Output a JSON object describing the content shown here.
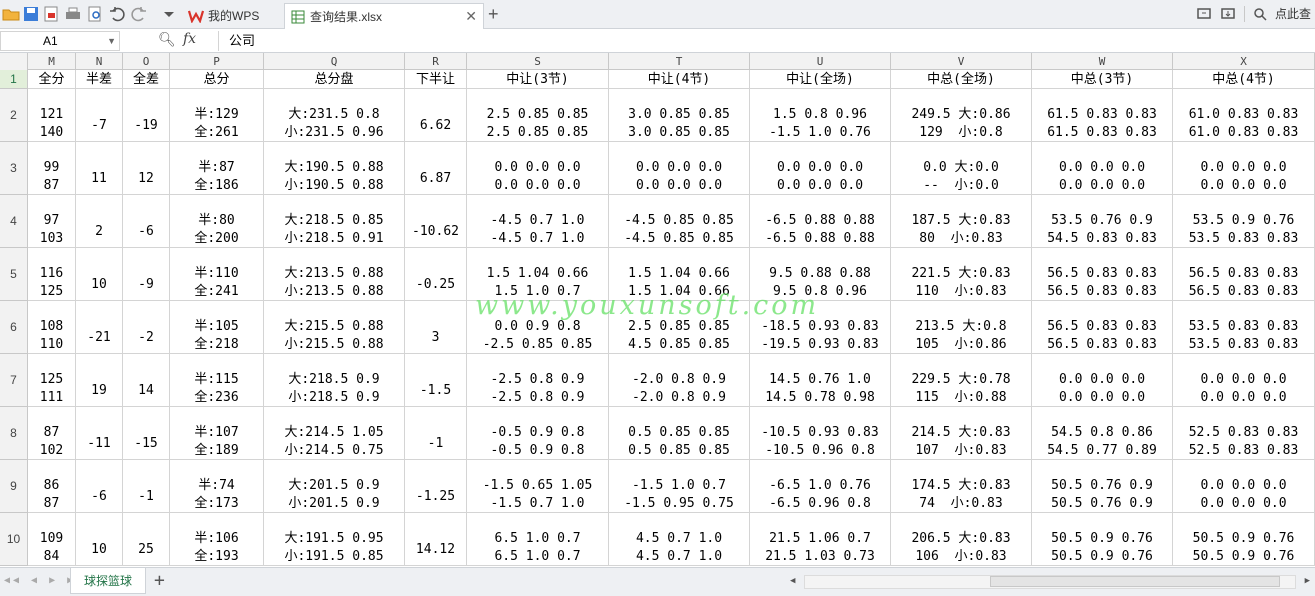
{
  "tabs": [
    {
      "label": "我的WPS"
    },
    {
      "label": "查询结果.xlsx"
    }
  ],
  "search_label": "点此查",
  "name_box": "A1",
  "formula_value": "公司",
  "sheet_tab": "球探篮球",
  "watermark": "www.youxunsoft.com",
  "columns": [
    "M",
    "N",
    "O",
    "P",
    "Q",
    "R",
    "S",
    "T",
    "U",
    "V",
    "W",
    "X"
  ],
  "headers": [
    "全分",
    "半差",
    "全差",
    "总分",
    "总分盘",
    "下半让",
    "中让(3节)",
    "中让(4节)",
    "中让(全场)",
    "中总(全场)",
    "中总(3节)",
    "中总(4节)"
  ],
  "rows": [
    {
      "num": "1"
    },
    {
      "num": "2",
      "cells": [
        [
          "121",
          "140"
        ],
        [
          "",
          "-7"
        ],
        [
          "",
          "-19"
        ],
        [
          "半:129",
          "全:261"
        ],
        [
          "大:231.5 0.8",
          "小:231.5 0.96"
        ],
        [
          "",
          "6.62"
        ],
        [
          "2.5 0.85 0.85",
          "2.5 0.85 0.85"
        ],
        [
          "3.0 0.85 0.85",
          "3.0 0.85 0.85"
        ],
        [
          "1.5 0.8 0.96",
          "-1.5 1.0 0.76"
        ],
        [
          "249.5 大:0.86",
          "129  小:0.8"
        ],
        [
          "61.5 0.83 0.83",
          "61.5 0.83 0.83"
        ],
        [
          "61.0 0.83 0.83",
          "61.0 0.83 0.83"
        ]
      ]
    },
    {
      "num": "3",
      "cells": [
        [
          "99",
          "87"
        ],
        [
          "",
          "11"
        ],
        [
          "",
          "12"
        ],
        [
          "半:87",
          "全:186"
        ],
        [
          "大:190.5 0.88",
          "小:190.5 0.88"
        ],
        [
          "",
          "6.87"
        ],
        [
          "0.0 0.0 0.0",
          "0.0 0.0 0.0"
        ],
        [
          "0.0 0.0 0.0",
          "0.0 0.0 0.0"
        ],
        [
          "0.0 0.0 0.0",
          "0.0 0.0 0.0"
        ],
        [
          "0.0 大:0.0",
          "--  小:0.0"
        ],
        [
          "0.0 0.0 0.0",
          "0.0 0.0 0.0"
        ],
        [
          "0.0 0.0 0.0",
          "0.0 0.0 0.0"
        ]
      ]
    },
    {
      "num": "4",
      "cells": [
        [
          "97",
          "103"
        ],
        [
          "",
          "2"
        ],
        [
          "",
          "-6"
        ],
        [
          "半:80",
          "全:200"
        ],
        [
          "大:218.5 0.85",
          "小:218.5 0.91"
        ],
        [
          "",
          "-10.62"
        ],
        [
          "-4.5 0.7 1.0",
          "-4.5 0.7 1.0"
        ],
        [
          "-4.5 0.85 0.85",
          "-4.5 0.85 0.85"
        ],
        [
          "-6.5 0.88 0.88",
          "-6.5 0.88 0.88"
        ],
        [
          "187.5 大:0.83",
          "80  小:0.83"
        ],
        [
          "53.5 0.76 0.9",
          "54.5 0.83 0.83"
        ],
        [
          "53.5 0.9 0.76",
          "53.5 0.83 0.83"
        ]
      ]
    },
    {
      "num": "5",
      "cells": [
        [
          "116",
          "125"
        ],
        [
          "",
          "10"
        ],
        [
          "",
          "-9"
        ],
        [
          "半:110",
          "全:241"
        ],
        [
          "大:213.5 0.88",
          "小:213.5 0.88"
        ],
        [
          "",
          "-0.25"
        ],
        [
          "1.5 1.04 0.66",
          "1.5 1.0 0.7"
        ],
        [
          "1.5 1.04 0.66",
          "1.5 1.04 0.66"
        ],
        [
          "9.5 0.88 0.88",
          "9.5 0.8 0.96"
        ],
        [
          "221.5 大:0.83",
          "110  小:0.83"
        ],
        [
          "56.5 0.83 0.83",
          "56.5 0.83 0.83"
        ],
        [
          "56.5 0.83 0.83",
          "56.5 0.83 0.83"
        ]
      ]
    },
    {
      "num": "6",
      "cells": [
        [
          "108",
          "110"
        ],
        [
          "",
          "-21"
        ],
        [
          "",
          "-2"
        ],
        [
          "半:105",
          "全:218"
        ],
        [
          "大:215.5 0.88",
          "小:215.5 0.88"
        ],
        [
          "",
          "3"
        ],
        [
          "0.0 0.9 0.8",
          "-2.5 0.85 0.85"
        ],
        [
          "2.5 0.85 0.85",
          "4.5 0.85 0.85"
        ],
        [
          "-18.5 0.93 0.83",
          "-19.5 0.93 0.83"
        ],
        [
          "213.5 大:0.8",
          "105  小:0.86"
        ],
        [
          "56.5 0.83 0.83",
          "56.5 0.83 0.83"
        ],
        [
          "53.5 0.83 0.83",
          "53.5 0.83 0.83"
        ]
      ]
    },
    {
      "num": "7",
      "cells": [
        [
          "125",
          "111"
        ],
        [
          "",
          "19"
        ],
        [
          "",
          "14"
        ],
        [
          "半:115",
          "全:236"
        ],
        [
          "大:218.5 0.9",
          "小:218.5 0.9"
        ],
        [
          "",
          "-1.5"
        ],
        [
          "-2.5 0.8 0.9",
          "-2.5 0.8 0.9"
        ],
        [
          "-2.0 0.8 0.9",
          "-2.0 0.8 0.9"
        ],
        [
          "14.5 0.76 1.0",
          "14.5 0.78 0.98"
        ],
        [
          "229.5 大:0.78",
          "115  小:0.88"
        ],
        [
          "0.0 0.0 0.0",
          "0.0 0.0 0.0"
        ],
        [
          "0.0 0.0 0.0",
          "0.0 0.0 0.0"
        ]
      ]
    },
    {
      "num": "8",
      "cells": [
        [
          "87",
          "102"
        ],
        [
          "",
          "-11"
        ],
        [
          "",
          "-15"
        ],
        [
          "半:107",
          "全:189"
        ],
        [
          "大:214.5 1.05",
          "小:214.5 0.75"
        ],
        [
          "",
          "-1"
        ],
        [
          "-0.5 0.9 0.8",
          "-0.5 0.9 0.8"
        ],
        [
          "0.5 0.85 0.85",
          "0.5 0.85 0.85"
        ],
        [
          "-10.5 0.93 0.83",
          "-10.5 0.96 0.8"
        ],
        [
          "214.5 大:0.83",
          "107  小:0.83"
        ],
        [
          "54.5 0.8 0.86",
          "54.5 0.77 0.89"
        ],
        [
          "52.5 0.83 0.83",
          "52.5 0.83 0.83"
        ]
      ]
    },
    {
      "num": "9",
      "cells": [
        [
          "86",
          "87"
        ],
        [
          "",
          "-6"
        ],
        [
          "",
          "-1"
        ],
        [
          "半:74",
          "全:173"
        ],
        [
          "大:201.5 0.9",
          "小:201.5 0.9"
        ],
        [
          "",
          "-1.25"
        ],
        [
          "-1.5 0.65 1.05",
          "-1.5 0.7 1.0"
        ],
        [
          "-1.5 1.0 0.7",
          "-1.5 0.95 0.75"
        ],
        [
          "-6.5 1.0 0.76",
          "-6.5 0.96 0.8"
        ],
        [
          "174.5 大:0.83",
          "74  小:0.83"
        ],
        [
          "50.5 0.76 0.9",
          "50.5 0.76 0.9"
        ],
        [
          "0.0 0.0 0.0",
          "0.0 0.0 0.0"
        ]
      ]
    },
    {
      "num": "10",
      "cells": [
        [
          "109",
          "84"
        ],
        [
          "",
          "10"
        ],
        [
          "",
          "25"
        ],
        [
          "半:106",
          "全:193"
        ],
        [
          "大:191.5 0.95",
          "小:191.5 0.85"
        ],
        [
          "",
          "14.12"
        ],
        [
          "6.5 1.0 0.7",
          "6.5 1.0 0.7"
        ],
        [
          "4.5 0.7 1.0",
          "4.5 0.7 1.0"
        ],
        [
          "21.5 1.06 0.7",
          "21.5 1.03 0.73"
        ],
        [
          "206.5 大:0.83",
          "106  小:0.83"
        ],
        [
          "50.5 0.9 0.76",
          "50.5 0.9 0.76"
        ],
        [
          "50.5 0.9 0.76",
          "50.5 0.9 0.76"
        ]
      ]
    }
  ]
}
